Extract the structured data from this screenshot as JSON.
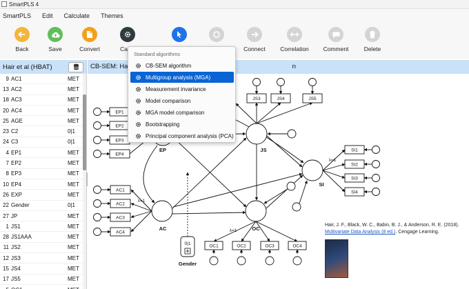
{
  "window": {
    "title": "SmartPLS 4"
  },
  "menu": [
    "SmartPLS",
    "Edit",
    "Calculate",
    "Themes"
  ],
  "toolbar": {
    "back": "Back",
    "save": "Save",
    "convert": "Convert",
    "calculate": "Calcu",
    "connect": "Connect",
    "correlation": "Correlation",
    "comment": "Comment",
    "delete": "Delete"
  },
  "colors": {
    "back": "#f4b63a",
    "save": "#5fbf5a",
    "convert": "#f2a11b",
    "calculate": "#2e3b3f",
    "select": "#1e73e8",
    "disabled": "#d4d4d4",
    "header": "#c9e1f9"
  },
  "left_panel": {
    "title": "Hair et al (HBAT)",
    "rows": [
      {
        "num": "9",
        "name": "AC1",
        "type": "MET"
      },
      {
        "num": "13",
        "name": "AC2",
        "type": "MET"
      },
      {
        "num": "18",
        "name": "AC3",
        "type": "MET"
      },
      {
        "num": "20",
        "name": "AC4",
        "type": "MET"
      },
      {
        "num": "25",
        "name": "AGE",
        "type": "MET"
      },
      {
        "num": "23",
        "name": "C2",
        "type": "0|1"
      },
      {
        "num": "24",
        "name": "C3",
        "type": "0|1"
      },
      {
        "num": "4",
        "name": "EP1",
        "type": "MET"
      },
      {
        "num": "7",
        "name": "EP2",
        "type": "MET"
      },
      {
        "num": "8",
        "name": "EP3",
        "type": "MET"
      },
      {
        "num": "10",
        "name": "EP4",
        "type": "MET"
      },
      {
        "num": "26",
        "name": "EXP",
        "type": "MET"
      },
      {
        "num": "22",
        "name": "Gender",
        "type": "0|1"
      },
      {
        "num": "27",
        "name": "JP",
        "type": "MET"
      },
      {
        "num": "1",
        "name": "JS1",
        "type": "MET"
      },
      {
        "num": "28",
        "name": "JS1AAA",
        "type": "MET"
      },
      {
        "num": "11",
        "name": "JS2",
        "type": "MET"
      },
      {
        "num": "12",
        "name": "JS3",
        "type": "MET"
      },
      {
        "num": "15",
        "name": "JS4",
        "type": "MET"
      },
      {
        "num": "17",
        "name": "JS5",
        "type": "MET"
      },
      {
        "num": "5",
        "name": "OC1",
        "type": "MET"
      }
    ]
  },
  "canvas": {
    "title_start": "CB-SEM: Hair",
    "title_end": "n"
  },
  "dropdown": {
    "header": "Standard algorithms",
    "items": [
      "CB-SEM algorithm",
      "Multigroup analysis (MGA)",
      "Measurement invariance",
      "Model comparison",
      "MGA model comparison",
      "Bootstrapping",
      "Principal component analysis (PCA)"
    ],
    "selected_index": 1
  },
  "model": {
    "constructs": {
      "ep": "EP",
      "js": "JS",
      "si": "SI",
      "ac": "AC",
      "oc": "OC",
      "gender": "Gender"
    },
    "indicators": {
      "ep": [
        "EP1",
        "EP2",
        "EP3",
        "EP4"
      ],
      "js": [
        "JS3",
        "JS4",
        "JS5"
      ],
      "si": [
        "SI1",
        "SI2",
        "SI3",
        "SI4"
      ],
      "ac": [
        "AC1",
        "AC2",
        "AC3",
        "AC4"
      ],
      "oc": [
        "OC1",
        "OC2",
        "OC3",
        "OC4"
      ]
    },
    "lambda_label": "λ=1",
    "moderator_label": "0|1"
  },
  "reference": {
    "line1": "Hair, J. F., Black, W. C., Babin, B. J., & Anderson, R. E. (2018).",
    "link": "Multivariate Data Analysis (8 ed.)",
    "line2_tail": ". Cengage Learning."
  }
}
